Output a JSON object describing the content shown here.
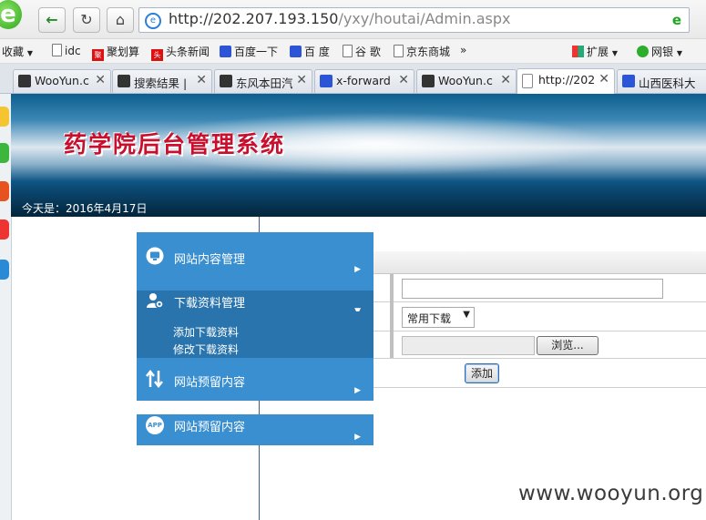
{
  "browser": {
    "url_host": "http://202.207.193.150",
    "url_path": "/yxy/houtai/Admin.aspx",
    "favorites": [
      {
        "label": "收藏",
        "icon": "star-icon"
      },
      {
        "label": "idc",
        "icon": "page-icon"
      },
      {
        "label": "聚划算",
        "icon": "juhuasuan-icon"
      },
      {
        "label": "头条新闻",
        "icon": "toutiao-icon"
      },
      {
        "label": "百度一下",
        "icon": "baidu-paw-icon"
      },
      {
        "label": "百 度",
        "icon": "baidu-paw-icon"
      },
      {
        "label": "谷 歌",
        "icon": "page-icon"
      },
      {
        "label": "京东商城",
        "icon": "page-icon"
      },
      {
        "label": "扩展",
        "icon": "extensions-icon"
      },
      {
        "label": "网银",
        "icon": "shield-icon"
      }
    ],
    "more": "»",
    "tabs": [
      {
        "title": "WooYun.c",
        "icon": "tab-icon"
      },
      {
        "title": "搜索结果 |",
        "icon": "tab-icon"
      },
      {
        "title": "东风本田汽",
        "icon": "tab-icon"
      },
      {
        "title": "x-forward",
        "icon": "baidu-paw-icon"
      },
      {
        "title": "WooYun.c",
        "icon": "tab-icon"
      },
      {
        "title": "http://202",
        "icon": "page-icon"
      },
      {
        "title": "山西医科大",
        "icon": "baidu-paw-icon"
      }
    ],
    "close": "✕"
  },
  "page": {
    "banner_title": "药学院后台管理系统",
    "date_text": "今天是：2016年4月17日"
  },
  "menu": {
    "items": [
      {
        "label": "网站内容管理",
        "icon": "monitor-icon",
        "arrow": "▶"
      },
      {
        "label": "下载资料管理",
        "icon": "user-settings-icon",
        "arrow": "▼"
      },
      {
        "label": "网站预留内容",
        "icon": "swap-arrows-icon",
        "arrow": "▶"
      },
      {
        "label": "网站预留内容",
        "icon": "app-icon",
        "arrow": "▶"
      }
    ],
    "sub_items": [
      "添加下载资料",
      "修改下载资料"
    ],
    "app_badge": "APP"
  },
  "form": {
    "title_value": "",
    "category_selected": "常用下载",
    "file_value": "",
    "browse_label": "浏览...",
    "submit_label": "添加"
  },
  "watermark": "www.wooyun.org",
  "colors": {
    "menu_blue": "#3a8fd0",
    "menu_sub_blue": "#2a74ad",
    "banner_title_red": "#c8102e"
  }
}
